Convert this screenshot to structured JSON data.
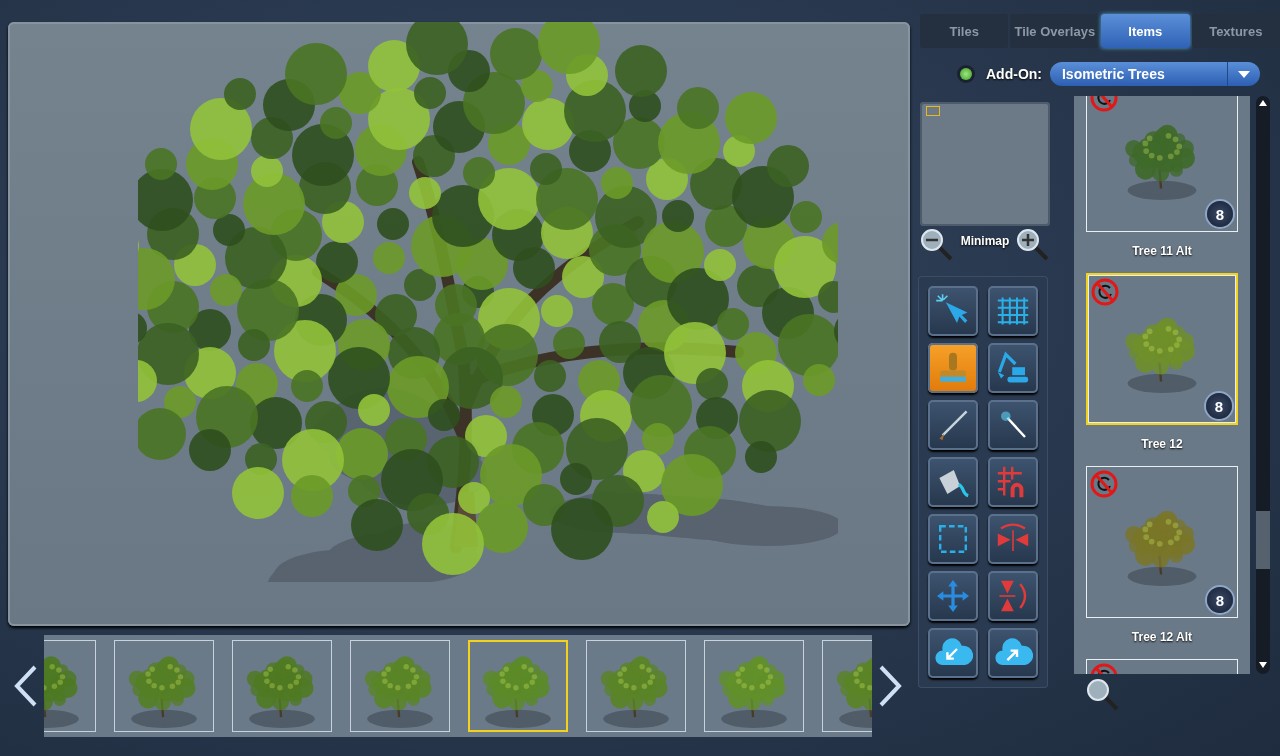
{
  "tabs": [
    {
      "label": "Tiles",
      "selected": false
    },
    {
      "label": "Tile Overlays",
      "selected": false
    },
    {
      "label": "Items",
      "selected": true
    },
    {
      "label": "Textures",
      "selected": false
    }
  ],
  "addon": {
    "indicator_on": true,
    "label": "Add-On:",
    "value": "Isometric Trees"
  },
  "minimap": {
    "label": "Minimap"
  },
  "tools": [
    {
      "kind": "pointer",
      "selected": false
    },
    {
      "kind": "grid",
      "selected": false
    },
    {
      "kind": "stamp",
      "selected": true
    },
    {
      "kind": "excavator",
      "selected": false
    },
    {
      "kind": "brush",
      "selected": false
    },
    {
      "kind": "wand",
      "selected": false
    },
    {
      "kind": "bucket",
      "selected": false
    },
    {
      "kind": "fence",
      "selected": false
    },
    {
      "kind": "selection",
      "selected": false
    },
    {
      "kind": "flip-horizontal",
      "selected": false
    },
    {
      "kind": "move",
      "selected": false
    },
    {
      "kind": "flip-vertical",
      "selected": false
    },
    {
      "kind": "import",
      "selected": false
    },
    {
      "kind": "export",
      "selected": false
    }
  ],
  "items": [
    {
      "name": "Tree 11 Alt",
      "badge": "8",
      "selected": false,
      "color": "#3f6a2a"
    },
    {
      "name": "Tree 12",
      "badge": "8",
      "selected": true,
      "color": "#6f8f2a"
    },
    {
      "name": "Tree 12 Alt",
      "badge": "8",
      "selected": false,
      "color": "#7a7628"
    }
  ],
  "filmstrip": [
    {
      "selected": false
    },
    {
      "selected": false
    },
    {
      "selected": false
    },
    {
      "selected": false
    },
    {
      "selected": true
    },
    {
      "selected": false
    },
    {
      "selected": false
    },
    {
      "selected": false
    }
  ]
}
